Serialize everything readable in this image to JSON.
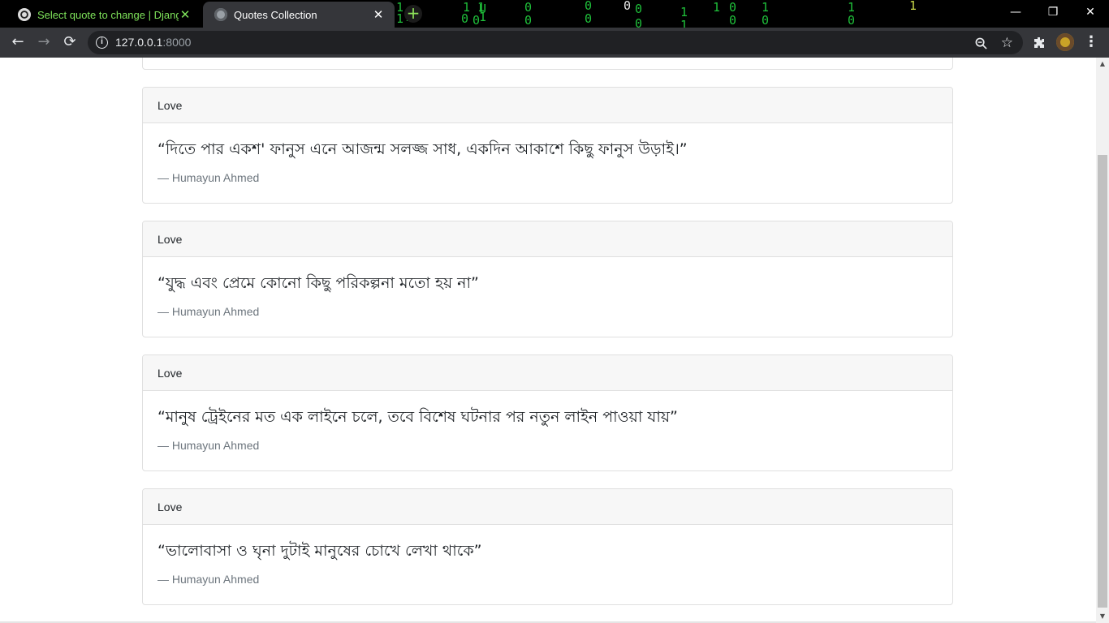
{
  "browser": {
    "tabs": [
      {
        "title": "Select quote to change | Django",
        "active": false,
        "color": "#7ee25a"
      },
      {
        "title": "Quotes Collection",
        "active": true,
        "color": "#ffffff"
      }
    ],
    "new_tab_symbol": "+",
    "window_controls": {
      "minimize": "—",
      "restore": "❐",
      "close": "✕"
    },
    "nav": {
      "back": "←",
      "forward": "→",
      "reload": "⟳"
    },
    "address": {
      "host": "127.0.0.1",
      "port": ":8000"
    },
    "icons": [
      "globe-icon",
      "info-icon",
      "zoom-icon",
      "star-icon",
      "extensions-icon",
      "profile-avatar",
      "menu-icon"
    ],
    "toolbar_glyphs": {
      "zoom": "🔍",
      "star": "☆",
      "extensions": "✱",
      "menu": "⋮",
      "info": "i"
    }
  },
  "quotes": [
    {
      "category": "Love",
      "text": "“দিতে পার একশ' ফানুস এনে আজন্ম সলজ্জ সাধ, একদিন আকাশে কিছু ফানুস উড়াই।”",
      "author": "— Humayun Ahmed"
    },
    {
      "category": "Love",
      "text": "“যুদ্ধ এবং প্রেমে কোনো কিছু পরিকল্পনা মতো হয় না”",
      "author": "— Humayun Ahmed"
    },
    {
      "category": "Love",
      "text": "“মানুষ ট্রেইনের মত এক লাইনে চলে, তবে বিশেষ ঘটনার পর নতুন লাইন পাওয়া যায়”",
      "author": "— Humayun Ahmed"
    },
    {
      "category": "Love",
      "text": "“ভালোবাসা ও ঘৃনা দুটাই মানুষের চোখে লেখা থাকে”",
      "author": "— Humayun Ahmed"
    }
  ],
  "colors": {
    "card_header_bg": "#f7f7f7",
    "card_border": "#dfdfdf",
    "author_text": "#6c757d",
    "toolbar_bg": "#35363a"
  }
}
